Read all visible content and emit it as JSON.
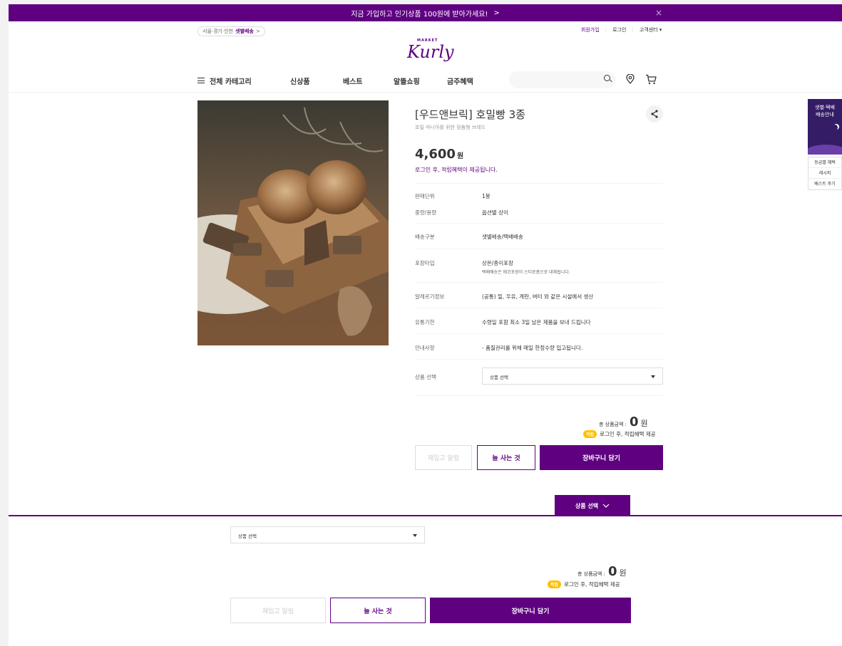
{
  "banner": {
    "text": "지금 가입하고 인기상품 100원에 받아가세요!",
    "arrow": ">",
    "close": "×"
  },
  "header": {
    "address": {
      "region": "서울·경기·인천",
      "delivery": "샛별배송",
      "arrow": ">"
    },
    "user_menu": {
      "join": "회원가입",
      "login": "로그인",
      "support": "고객센터 ▾"
    },
    "logo": {
      "market": "MARKET",
      "brand": "Kurly"
    }
  },
  "gnb": {
    "categories": "전체 카테고리",
    "items": [
      "신상품",
      "베스트",
      "알뜰쇼핑",
      "금주혜택"
    ]
  },
  "product": {
    "title": "[우드앤브릭] 호밀빵 3종",
    "subtitle": "호밀 마니아를 위한 맞춤형 브레드",
    "price": "4,600",
    "price_unit": "원",
    "login_benefit": "로그인 후, 적립혜택이 제공됩니다.",
    "info": [
      {
        "key": "판매단위",
        "value": "1봉"
      },
      {
        "key": "중량/용량",
        "value": "옵션별 상이"
      },
      {
        "key": "배송구분",
        "value": "샛별배송/택배배송"
      },
      {
        "key": "포장타입",
        "value": "상온/종이포장",
        "note": "택배배송은 에코포장이 스티로폼으로 대체됩니다."
      },
      {
        "key": "알레르기정보",
        "value": "(공통) 밀, 우유, 계란, 버터 와 같은 시설에서 생산"
      },
      {
        "key": "유통기한",
        "value": "수령일 포함 최소 3일 남은 제품을 보내 드립니다"
      },
      {
        "key": "안내사항",
        "value": "- 품질관리를 위해 매일 한정수량 입고됩니다."
      }
    ],
    "option_label": "상품 선택",
    "option_placeholder": "상품 선택"
  },
  "purchase": {
    "total_label": "총 상품금액 :",
    "total_amount": "0",
    "total_unit": "원",
    "accrual_badge": "적립",
    "accrual_text": "로그인 후, 적립혜택 제공",
    "restock_button": "재입고 알림",
    "frequent_button": "늘 사는 것",
    "cart_button": "장바구니 담기"
  },
  "sticky": {
    "tab_label": "상품 선택",
    "select_placeholder": "상품 선택"
  },
  "side": {
    "banner_line1": "샛별·택배",
    "banner_line2": "배송안내",
    "menu": [
      "등급별 혜택",
      "레시피",
      "베스트 후기"
    ]
  },
  "colors": {
    "brand": "#5f0080",
    "badge": "#ffbf00"
  }
}
